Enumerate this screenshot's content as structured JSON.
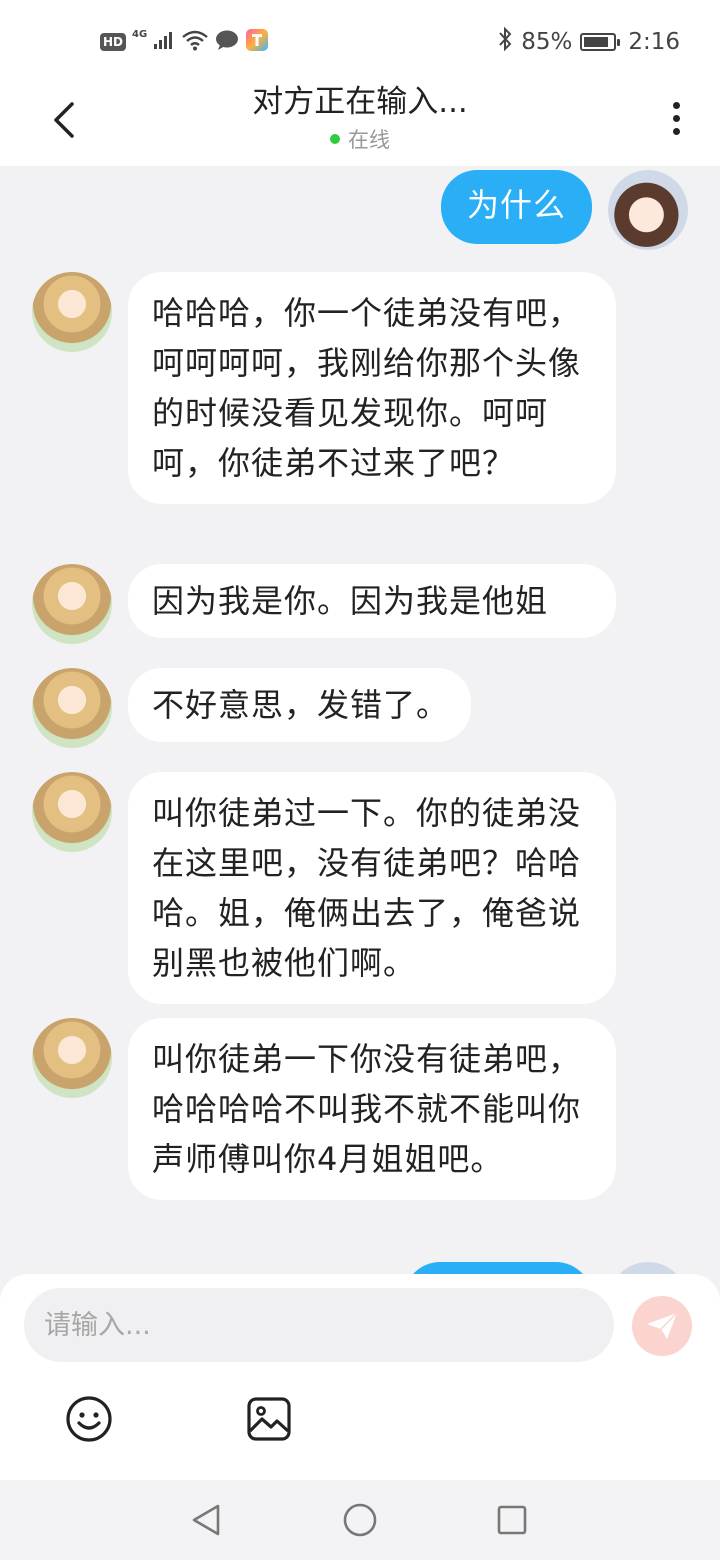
{
  "status_bar": {
    "hd": "HD",
    "network": "4G",
    "battery_text": "85%",
    "battery_level": 0.85,
    "time": "2:16"
  },
  "header": {
    "title": "对方正在输入...",
    "status": "在线",
    "status_color": "#2ecc40"
  },
  "messages": [
    {
      "from": "self",
      "text": "为什么"
    },
    {
      "from": "other",
      "text": "哈哈哈，你一个徒弟没有吧，呵呵呵呵，我刚给你那个头像的时候没看见发现你。呵呵呵，你徒弟不过来了吧？"
    },
    {
      "from": "other",
      "text": "因为我是你。因为我是他姐"
    },
    {
      "from": "other",
      "text": "不好意思，发错了。"
    },
    {
      "from": "other",
      "text": "叫你徒弟过一下。你的徒弟没在这里吧，没有徒弟吧？哈哈哈。姐，俺俩出去了，俺爸说别黑也被他们啊。"
    },
    {
      "from": "other",
      "text": "叫你徒弟一下你没有徒弟吧，哈哈哈哈不叫我不就不能叫你声师傅叫你4月姐姐吧。"
    },
    {
      "from": "self",
      "text": ""
    }
  ],
  "input": {
    "placeholder": "请输入...",
    "value": ""
  },
  "icons": {
    "back": "chevron-left-icon",
    "more": "more-vertical-icon",
    "send": "send-icon",
    "emoji": "emoji-icon",
    "image": "image-icon",
    "nav_back": "nav-back-icon",
    "nav_home": "nav-home-icon",
    "nav_recents": "nav-recents-icon"
  },
  "colors": {
    "self_bubble": "#2aaef6",
    "other_bubble": "#ffffff",
    "background": "#f2f2f4",
    "send_button": "#fbd3cf"
  }
}
